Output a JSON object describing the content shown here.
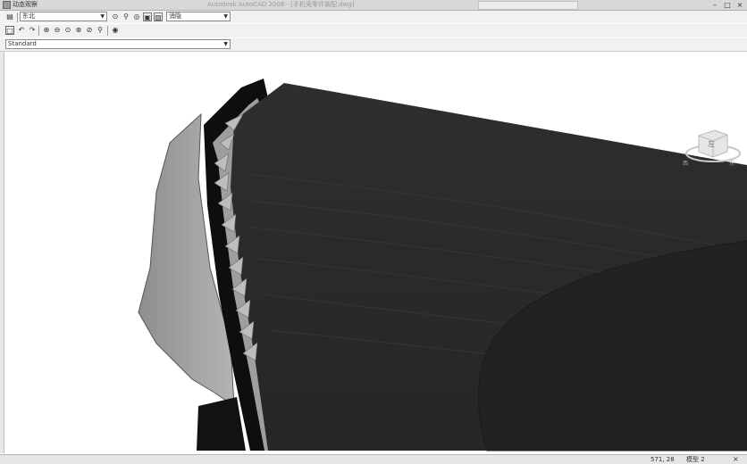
{
  "window": {
    "title": "动态观察",
    "title_faded": "Autodesk AutoCAD 2008 - [手机壳零件装配.dwg]",
    "minimize": "–",
    "maximize": "□",
    "close": "×"
  },
  "toolbar1": {
    "layer_select_value": "东北",
    "style_select_value": "消隐"
  },
  "toolbar3": {
    "visual_style_value": "Standard"
  },
  "viewcube": {
    "face_label": "左",
    "compass_left": "西",
    "compass_right": "东"
  },
  "status": {
    "coords": "571, 28",
    "mode": "模型 2",
    "close": "×"
  },
  "colors": {
    "model_dark": "#2b2b2b",
    "model_shadow": "#1e1e1e",
    "model_side": "#9a9a9a"
  },
  "icons": [
    "app-icon",
    "save-icon",
    "orbit-icon",
    "zoom-icon",
    "pan-icon",
    "view-icon",
    "undo-icon",
    "redo-icon",
    "zoom-in-icon",
    "zoom-out-icon",
    "zoom-window-icon",
    "zoom-extents-icon",
    "zoom-previous-icon",
    "help-icon"
  ]
}
